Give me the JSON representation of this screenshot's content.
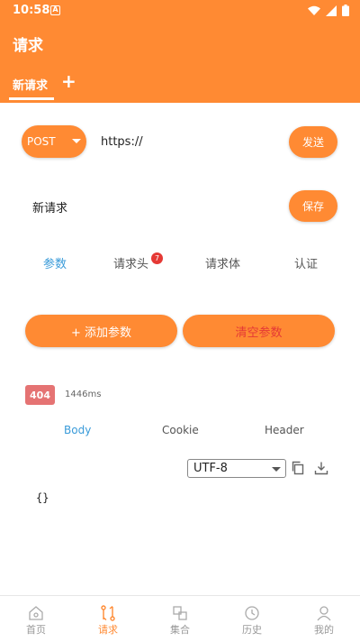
{
  "status_bar": {
    "time": "10:58",
    "notification_glyph": "A"
  },
  "app": {
    "title": "请求"
  },
  "request_tabs": {
    "active_label": "新请求",
    "add_label": "+"
  },
  "request": {
    "method": "POST",
    "url": "https://",
    "send_label": "发送",
    "name": "新请求",
    "save_label": "保存"
  },
  "param_tabs": [
    {
      "label": "参数"
    },
    {
      "label": "请求头",
      "badge": "7"
    },
    {
      "label": "请求体"
    },
    {
      "label": "认证"
    }
  ],
  "params": {
    "add_label": "+ 添加参数",
    "clear_label": "清空参数"
  },
  "response": {
    "status_code": "404",
    "time": "1446ms",
    "tabs": [
      "Body",
      "Cookie",
      "Header"
    ],
    "encoding": "UTF-8",
    "body": "{}"
  },
  "bottom_nav": [
    {
      "label": "首页",
      "icon": "home-icon"
    },
    {
      "label": "请求",
      "icon": "request-icon"
    },
    {
      "label": "集合",
      "icon": "collection-icon"
    },
    {
      "label": "历史",
      "icon": "history-icon"
    },
    {
      "label": "我的",
      "icon": "profile-icon"
    }
  ],
  "colors": {
    "accent": "#FF8A33",
    "active_tab": "#3A9BD9",
    "danger": "#E53935",
    "error_badge": "#E57373"
  }
}
